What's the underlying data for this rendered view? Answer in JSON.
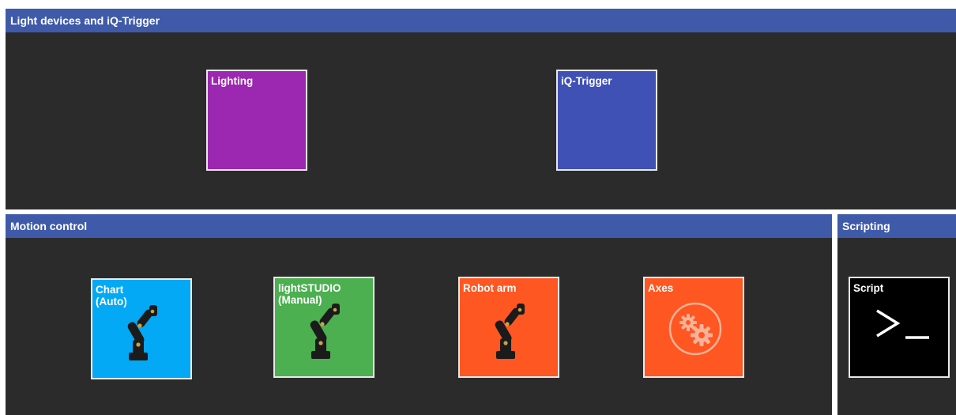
{
  "sections": {
    "light": {
      "title": "Light devices and iQ-Trigger",
      "tiles": [
        {
          "label": "Lighting",
          "color": "#9c27b0"
        },
        {
          "label": "iQ-Trigger",
          "color": "#3f51b5"
        }
      ]
    },
    "motion": {
      "title": "Motion control",
      "tiles": [
        {
          "label": "Chart\n(Auto)",
          "color": "#03a9f4",
          "icon": "robot-arm-icon"
        },
        {
          "label": "lightSTUDIO\n(Manual)",
          "color": "#4caf50",
          "icon": "robot-arm-icon"
        },
        {
          "label": "Robot arm",
          "color": "#ff5722",
          "icon": "robot-arm-icon"
        },
        {
          "label": "Axes",
          "color": "#ff5722",
          "icon": "gears-icon"
        }
      ]
    },
    "scripting": {
      "title": "Scripting",
      "tiles": [
        {
          "label": "Script",
          "color": "#000000",
          "icon": "terminal-prompt-icon"
        }
      ]
    }
  },
  "colors": {
    "header": "#3f5aa8",
    "panel_bg": "#2b2b2b",
    "tile_border": "#e9e9e9"
  }
}
